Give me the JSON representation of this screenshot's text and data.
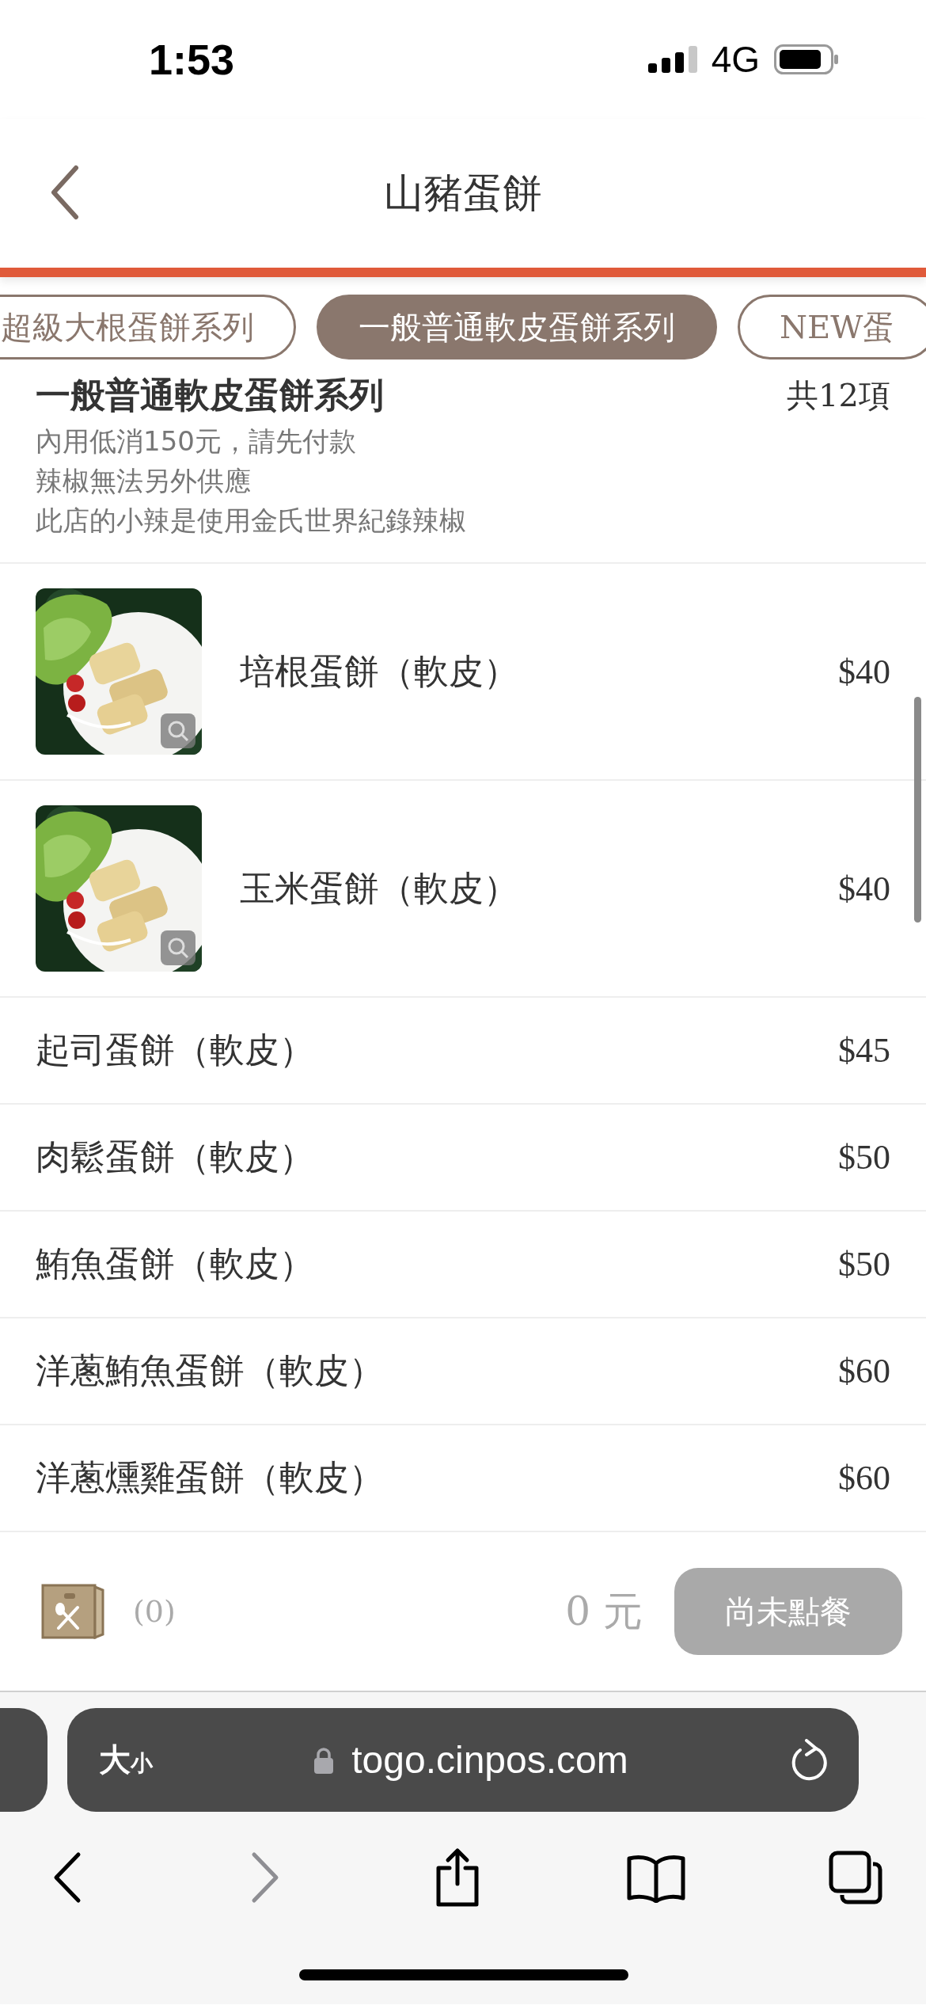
{
  "status_bar": {
    "time": "1:53",
    "network": "4G"
  },
  "header": {
    "title": "山豬蛋餅"
  },
  "tabs": [
    {
      "label": "超級大根蛋餅系列",
      "selected": false
    },
    {
      "label": "一般普通軟皮蛋餅系列",
      "selected": true
    },
    {
      "label": "NEW蛋",
      "selected": false
    }
  ],
  "section": {
    "title": "一般普通軟皮蛋餅系列",
    "count": "共12項",
    "notes": [
      "內用低消150元，請先付款",
      "辣椒無法另外供應",
      "此店的小辣是使用金氏世界紀錄辣椒"
    ]
  },
  "items": [
    {
      "name": "培根蛋餅（軟皮）",
      "price": "$40"
    },
    {
      "name": "玉米蛋餅（軟皮）",
      "price": "$40"
    },
    {
      "kind": "plain",
      "name": "起司蛋餅（軟皮）",
      "price": "$45"
    },
    {
      "kind": "plain",
      "name": "肉鬆蛋餅（軟皮）",
      "price": "$50"
    },
    {
      "kind": "plain",
      "name": "鮪魚蛋餅（軟皮）",
      "price": "$50"
    },
    {
      "kind": "plain",
      "name": "洋蔥鮪魚蛋餅（軟皮）",
      "price": "$60"
    },
    {
      "kind": "plain",
      "name": "洋蔥燻雞蛋餅（軟皮）",
      "price": "$60"
    }
  ],
  "cart": {
    "count": "(0)",
    "total": "0 元",
    "button": {
      "label": "尚未點餐",
      "disabled": true
    }
  },
  "browser": {
    "size_label": "大小",
    "url": "togo.cinpos.com",
    "toolbar": [
      {
        "kind": "back",
        "disabled": false
      },
      {
        "kind": "forward",
        "disabled": true
      },
      {
        "kind": "share",
        "disabled": false
      },
      {
        "kind": "bookmarks",
        "disabled": false
      },
      {
        "kind": "tabs",
        "disabled": false
      }
    ]
  }
}
